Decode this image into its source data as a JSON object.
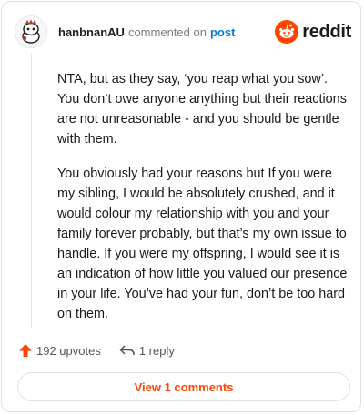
{
  "header": {
    "username": "hanbnanAU",
    "commented_text": "commented on",
    "post_link": "post",
    "brand_name": "reddit",
    "brand_color": "#ff4500",
    "avatar_icon": "snoo-avatar-icon",
    "brand_icon": "reddit-snoo-icon"
  },
  "comment": {
    "paragraphs": [
      "NTA, but as they say, ‘you reap what you sow’. You don’t owe anyone anything but their reactions are not unreasonable - and you should be gentle with them.",
      "You obviously had your reasons but If you were my sibling, I would be absolutely crushed, and it would colour my relationship with you and your family forever probably, but that’s my own issue to handle. If you were my offspring, I would see it is an indication of how little you valued our presence in your life. You’ve had your fun, don’t be too hard on them."
    ]
  },
  "actions": {
    "upvotes": "192 upvotes",
    "upvote_icon": "upvote-arrow-icon",
    "upvote_color": "#ff4500",
    "replies": "1 reply",
    "reply_icon": "reply-arrow-icon"
  },
  "footer": {
    "view_comments": "View 1 comments"
  }
}
